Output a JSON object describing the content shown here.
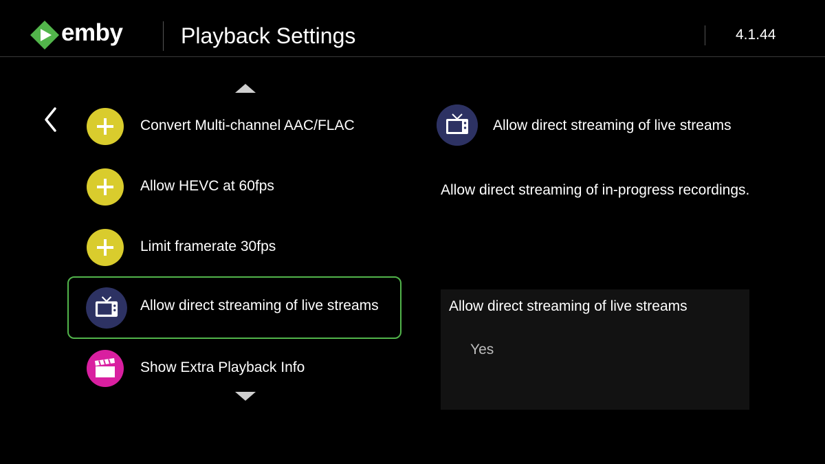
{
  "app": {
    "brand": "emby",
    "version": "4.1.44"
  },
  "header": {
    "title": "Playback Settings"
  },
  "colors": {
    "brand_green": "#52b54b",
    "plus_icon_bg": "#d9cc2d",
    "tv_icon_bg": "#2d3263",
    "clapper_icon_bg": "#d91fa0",
    "value_panel_bg": "#121212"
  },
  "settings": {
    "items": [
      {
        "label": "Convert Multi-channel AAC/FLAC",
        "icon": "plus-icon",
        "focused": false
      },
      {
        "label": "Allow HEVC at 60fps",
        "icon": "plus-icon",
        "focused": false
      },
      {
        "label": "Limit framerate 30fps",
        "icon": "plus-icon",
        "focused": false
      },
      {
        "label": "Allow direct streaming of live streams",
        "icon": "tv-icon",
        "focused": true
      },
      {
        "label": "Show Extra Playback Info",
        "icon": "clapperboard-icon",
        "focused": false
      }
    ]
  },
  "detail": {
    "title": "Allow direct streaming of live streams",
    "icon": "tv-icon",
    "description": "Allow direct streaming of in-progress recordings.",
    "value_panel": {
      "title": "Allow direct streaming of live streams",
      "value": "Yes"
    }
  },
  "navigation": {
    "back_icon": "chevron-left-icon",
    "scroll_up_icon": "triangle-up-icon",
    "scroll_down_icon": "triangle-down-icon"
  }
}
